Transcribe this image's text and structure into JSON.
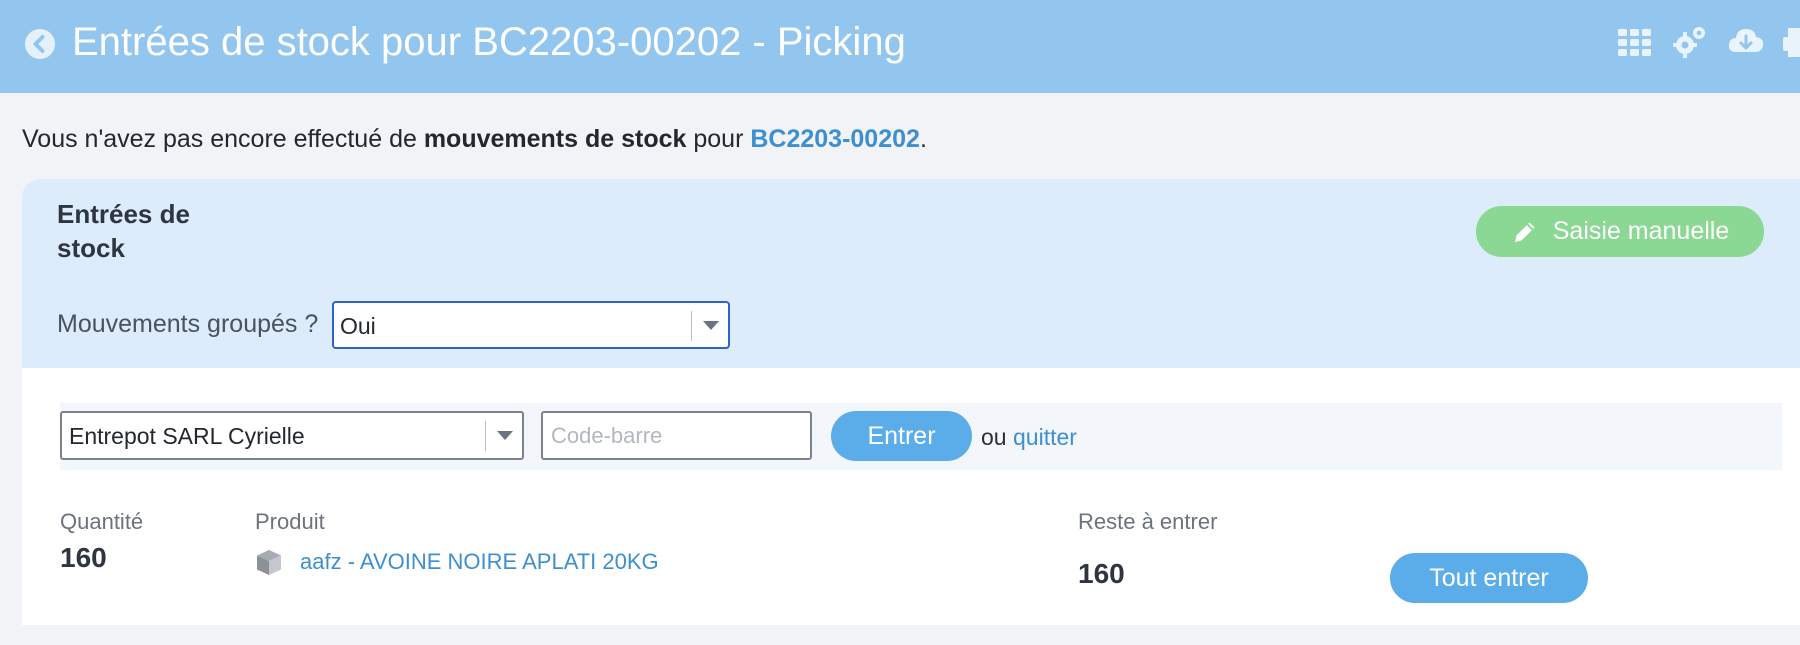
{
  "header": {
    "title": "Entrées de stock pour BC2203-00202 - Picking",
    "icons": [
      "back-icon",
      "apps-grid-icon",
      "settings-gears-icon",
      "cloud-download-icon",
      "print-icon"
    ]
  },
  "notice": {
    "prefix": "Vous n'avez pas encore effectué de ",
    "bold": "mouvements de stock",
    "middle": " pour ",
    "ref": "BC2203-00202",
    "suffix": "."
  },
  "card": {
    "title": "Entrées de stock",
    "manual_button": "Saisie manuelle",
    "grouped_label": "Mouvements groupés ?",
    "grouped_value": "Oui"
  },
  "toolbar": {
    "warehouse": "Entrepot SARL Cyrielle",
    "barcode_placeholder": "Code-barre",
    "enter_button": "Entrer",
    "or": "ou",
    "quit": "quitter"
  },
  "line": {
    "qty_label": "Quantité",
    "product_label": "Produit",
    "remaining_label": "Reste à entrer",
    "qty": "160",
    "product": "aafz - AVOINE NOIRE APLATI 20KG",
    "remaining": "160",
    "all_button": "Tout entrer"
  },
  "colors": {
    "header_bg": "#92c6ee",
    "accent_blue": "#5aade8",
    "link_blue": "#3d8fcf",
    "green_button": "#8ad893",
    "card_head_bg": "#dcecfa"
  }
}
